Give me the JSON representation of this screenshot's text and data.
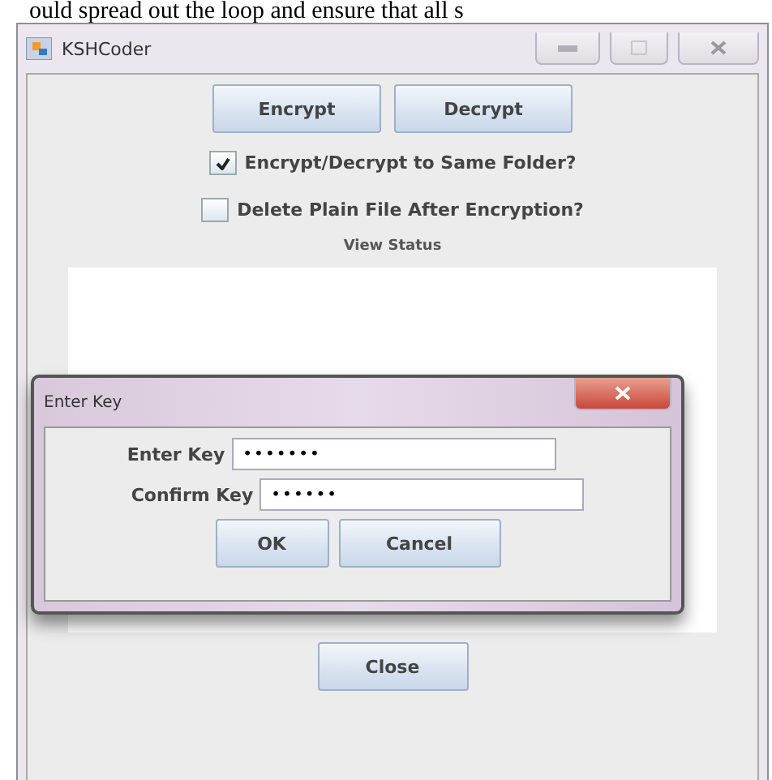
{
  "page_text": "ould spread out the loop and ensure that all s",
  "window": {
    "title": "KSHCoder",
    "active": false
  },
  "buttons": [
    {
      "label": "Encrypt"
    },
    {
      "label": "Decrypt"
    }
  ],
  "options": [
    {
      "label": "Encrypt/Decrypt to Same Folder?",
      "checked": true
    },
    {
      "label": "Delete Plain File After Encryption?",
      "checked": false
    }
  ],
  "status": {
    "label": "View Status"
  },
  "dialog": {
    "title": "Enter Key",
    "active": true,
    "fields": [
      {
        "label": "Enter Key",
        "value": "•••••••"
      },
      {
        "label": "Confirm Key",
        "value": "••••••"
      }
    ],
    "buttons": [
      {
        "label": "OK"
      },
      {
        "label": "Cancel"
      }
    ]
  },
  "close_button": {
    "label": "Close"
  }
}
